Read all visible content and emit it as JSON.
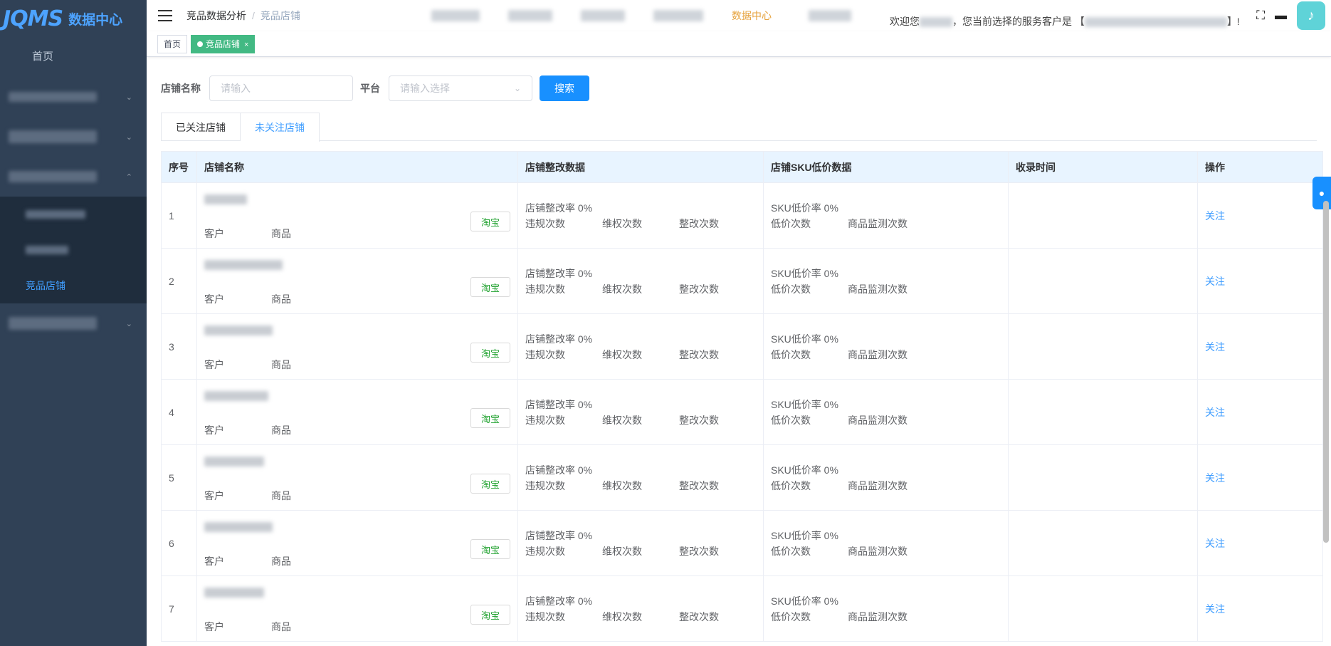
{
  "logo": {
    "mark": "JQMS",
    "text": "数据中心"
  },
  "sidebar": {
    "home": "首页",
    "sub_active": "竞品店铺"
  },
  "breadcrumb": {
    "parent": "竞品数据分析",
    "separator": "/",
    "current": "竞品店铺"
  },
  "topmenu": {
    "active": "数据中心"
  },
  "welcome": {
    "prefix": "欢迎您",
    "middle": "，您当前选择的服务客户是 【",
    "suffix": "】!"
  },
  "tags": {
    "home": "首页",
    "active": "竞品店铺",
    "close": "×"
  },
  "search": {
    "shop_label": "店铺名称",
    "shop_placeholder": "请输入",
    "platform_label": "平台",
    "platform_placeholder": "请输入选择",
    "button": "搜索"
  },
  "tabs": {
    "followed": "已关注店铺",
    "unfollowed": "未关注店铺"
  },
  "table": {
    "headers": [
      "序号",
      "店铺名称",
      "店铺整改数据",
      "店铺SKU低价数据",
      "收录时间",
      "操作"
    ],
    "row_labels": {
      "customer": "客户",
      "product": "商品",
      "platform": "淘宝",
      "rectify_rate": "店铺整改率 0%",
      "violations": "违规次数",
      "rights": "维权次数",
      "rectify_count": "整改次数",
      "sku_rate": "SKU低价率 0%",
      "low_price": "低价次数",
      "monitor": "商品监测次数",
      "action": "关注"
    },
    "rows": [
      "1",
      "2",
      "3",
      "4",
      "5",
      "6",
      "7"
    ]
  }
}
